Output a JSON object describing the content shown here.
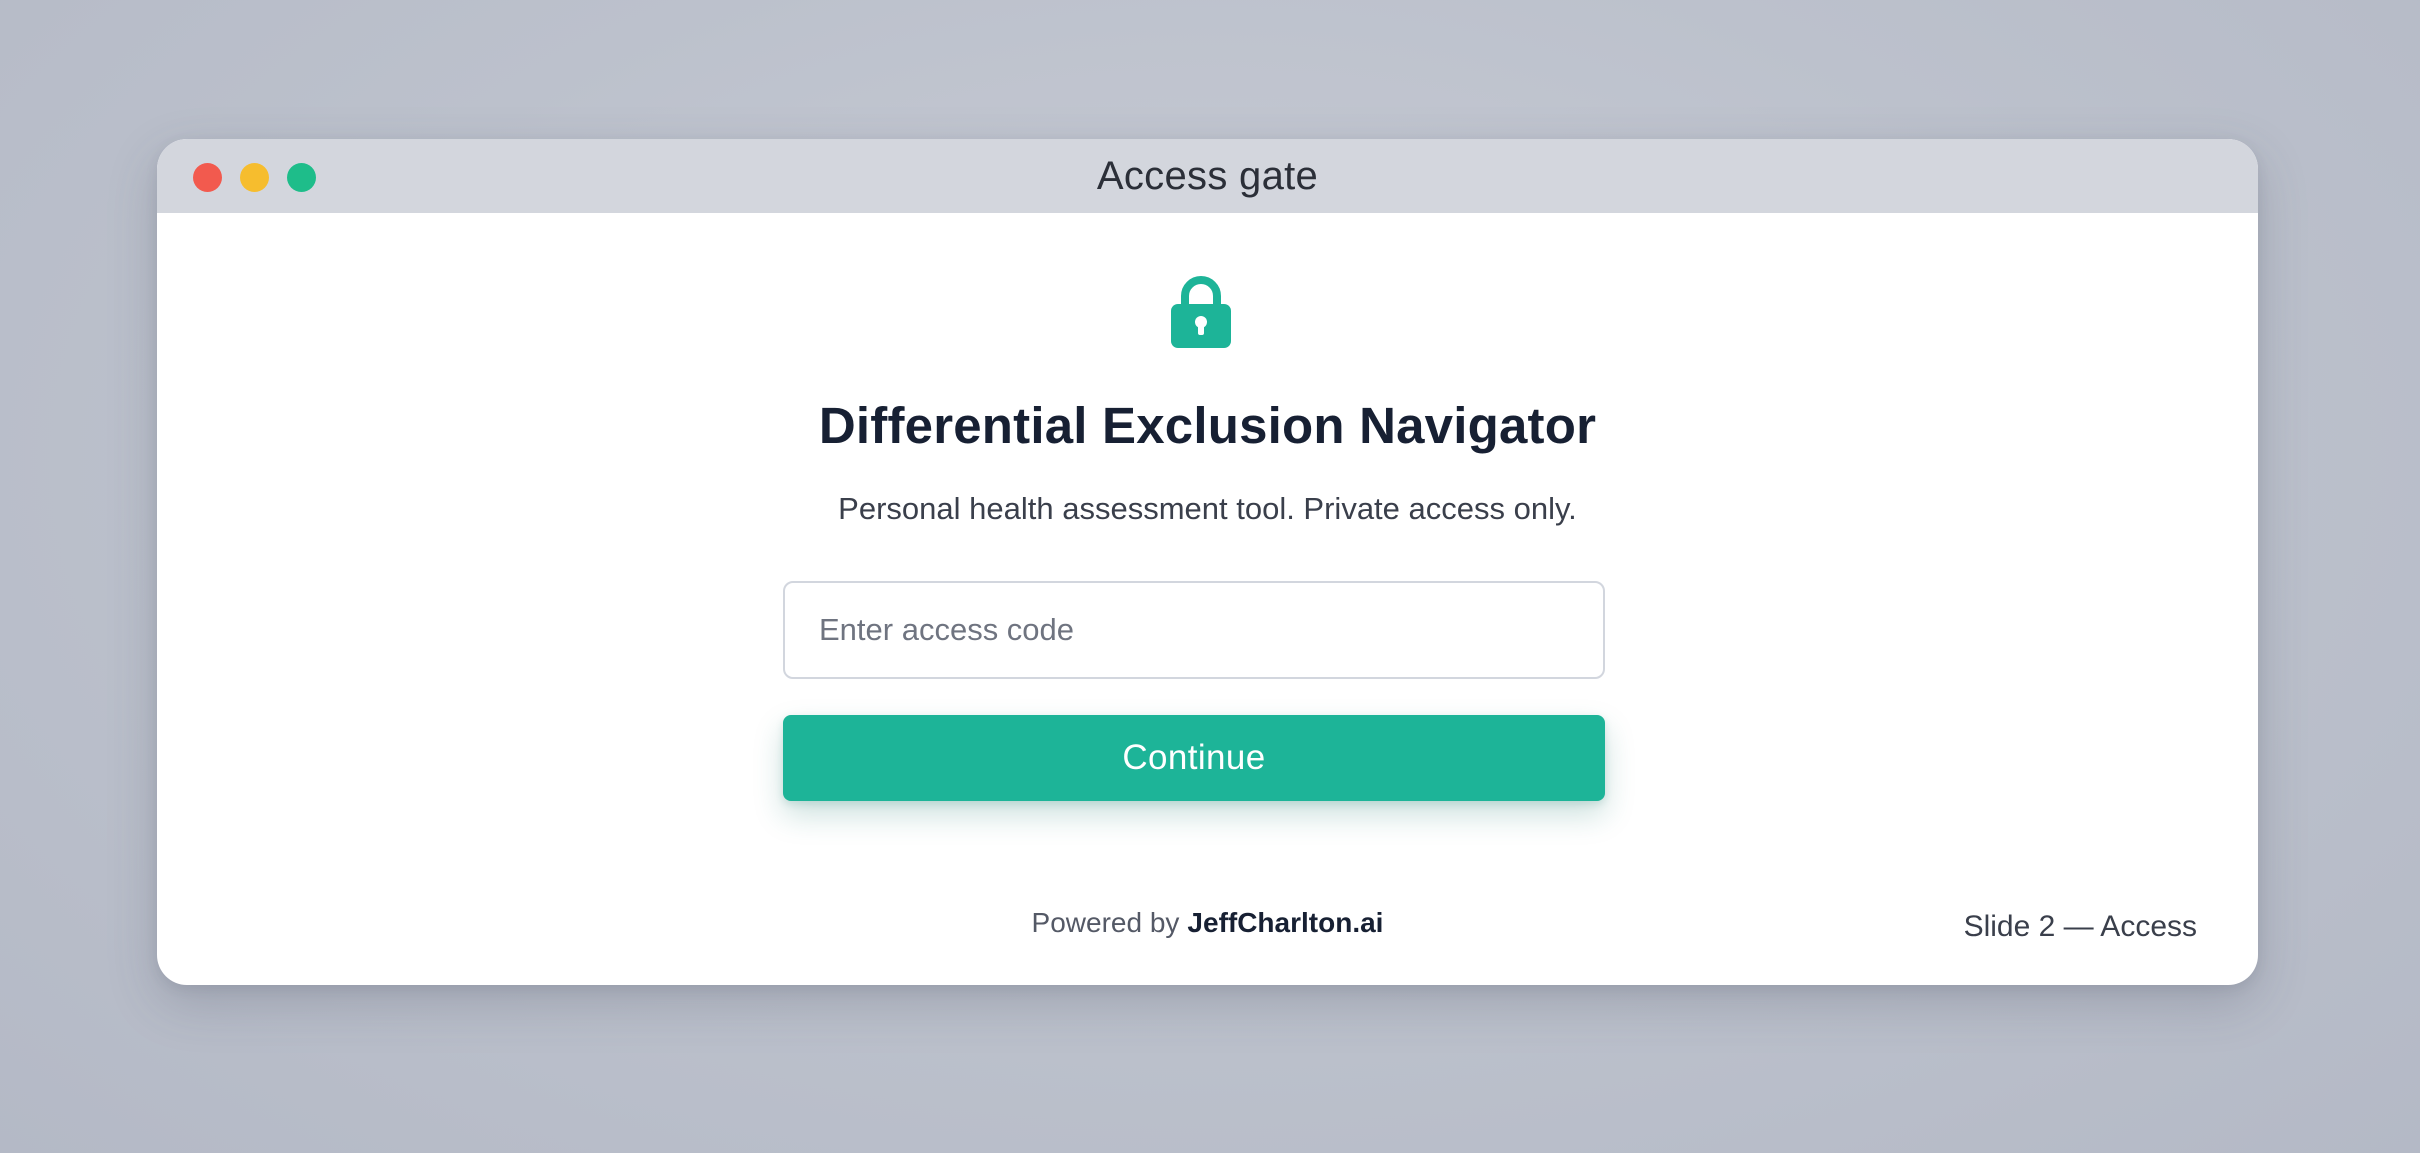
{
  "window": {
    "title": "Access gate",
    "controls": [
      "close",
      "minimize",
      "zoom"
    ]
  },
  "icons": {
    "lock": "lock-icon"
  },
  "colors": {
    "accent": "#1db498",
    "titlebar": "#d3d6dd",
    "close": "#f25a4e",
    "minimize": "#f6bd2e",
    "zoom": "#1ebd8a"
  },
  "main": {
    "title": "Differential Exclusion Navigator",
    "subtitle": "Personal health assessment tool. Private access only.",
    "access_code": {
      "value": "",
      "placeholder": "Enter access code"
    },
    "continue_label": "Continue"
  },
  "footer": {
    "powered_prefix": "Powered by",
    "brand": "JeffCharlton.ai"
  },
  "slide_label": "Slide 2 — Access"
}
